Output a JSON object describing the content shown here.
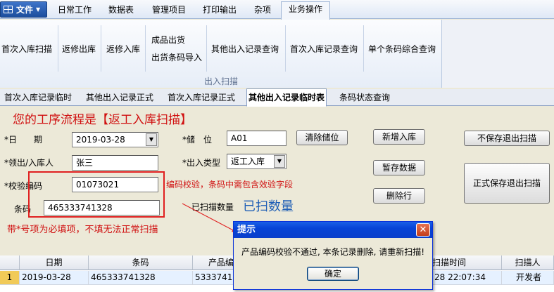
{
  "menu": {
    "file_label": "文件",
    "tabs": [
      "日常工作",
      "数据表",
      "管理项目",
      "打印输出",
      "杂项",
      "业务操作"
    ]
  },
  "ribbon": {
    "buttons": [
      "首次入库扫描",
      "返修出库",
      "返修入库",
      "成品出货",
      "出货条码导入",
      "其他出入记录查询",
      "首次入库记录查询",
      "单个条码综合查询"
    ],
    "group_label": "出入扫描"
  },
  "subtabs": [
    "首次入库记录临时",
    "其他出入记录正式",
    "首次入库记录正式",
    "其他出入记录临时表",
    "条码状态查询"
  ],
  "form": {
    "workflow_text": "您的工序流程是【返工入库扫描】",
    "date_label": "*日　　期",
    "date_value": "2019-03-28",
    "person_label": "*领出/入库人",
    "person_value": "张三",
    "verify_label": "*校验编码",
    "verify_value": "01073021",
    "barcode_label": "条码",
    "barcode_value": "465333741328",
    "storage_label": "*储　位",
    "storage_value": "A01",
    "inout_type_label": "*出入类型",
    "inout_type_value": "返工入库",
    "scanned_label": "已扫描数量",
    "scanned_count_text": "已扫数量",
    "annot_verify": "编码校验，条码中需包含效验字段",
    "annot_required": "带*号项为必填项，不填无法正常扫描"
  },
  "buttons": {
    "clear_storage": "清除储位",
    "new_inbound": "新增入库",
    "save_temp": "暂存数据",
    "delete_row": "删除行",
    "exit_nosave": "不保存退出扫描",
    "exit_save": "正式保存退出扫描"
  },
  "grid": {
    "columns": [
      "日期",
      "条码",
      "产品编",
      "扫描时间",
      "扫描人"
    ],
    "rows": [
      {
        "num": "1",
        "date": "2019-03-28",
        "barcode": "465333741328",
        "product": "53337413",
        "scan_time": "28 22:07:34",
        "scanner": "开发者"
      }
    ]
  },
  "dialog": {
    "title": "提示",
    "message": "产品编码校验不通过, 本条记录删除, 请重新扫描!",
    "ok": "确定"
  }
}
